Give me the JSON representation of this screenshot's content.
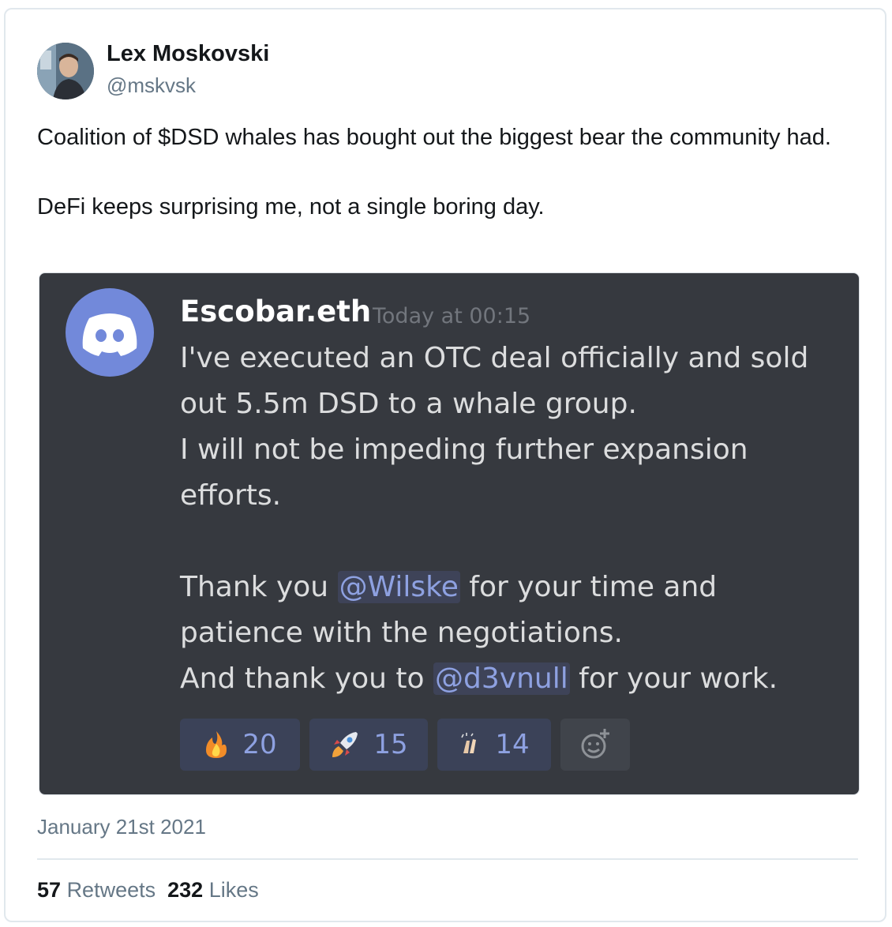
{
  "author": {
    "name": "Lex Moskovski",
    "handle": "@mskvsk"
  },
  "tweet": {
    "text": "Coalition of $DSD whales has bought out the biggest bear the community had.\n\nDeFi keeps surprising me, not a single boring day.",
    "date": "January 21st 2021",
    "retweets_count": "57",
    "retweets_label": "Retweets",
    "likes_count": "232",
    "likes_label": "Likes"
  },
  "discord_message": {
    "username": "Escobar.eth",
    "timestamp": "Today at 00:15",
    "line1": "I've executed an OTC deal officially and sold out 5.5m DSD to a whale group.",
    "line2": "I will not be impeding further expansion efforts.",
    "thanks1_pre": "Thank you ",
    "mention1": "@Wilske",
    "thanks1_post": " for your time and patience with the negotiations.",
    "thanks2_pre": "And thank you to ",
    "mention2": "@d3vnull",
    "thanks2_post": " for your work.",
    "reactions": [
      {
        "emoji": "fire",
        "count": "20"
      },
      {
        "emoji": "rocket",
        "count": "15"
      },
      {
        "emoji": "clapping-hands",
        "count": "14"
      }
    ],
    "colors": {
      "background": "#36393f",
      "mention": "#8ea1e1",
      "blurple": "#7289da"
    }
  }
}
